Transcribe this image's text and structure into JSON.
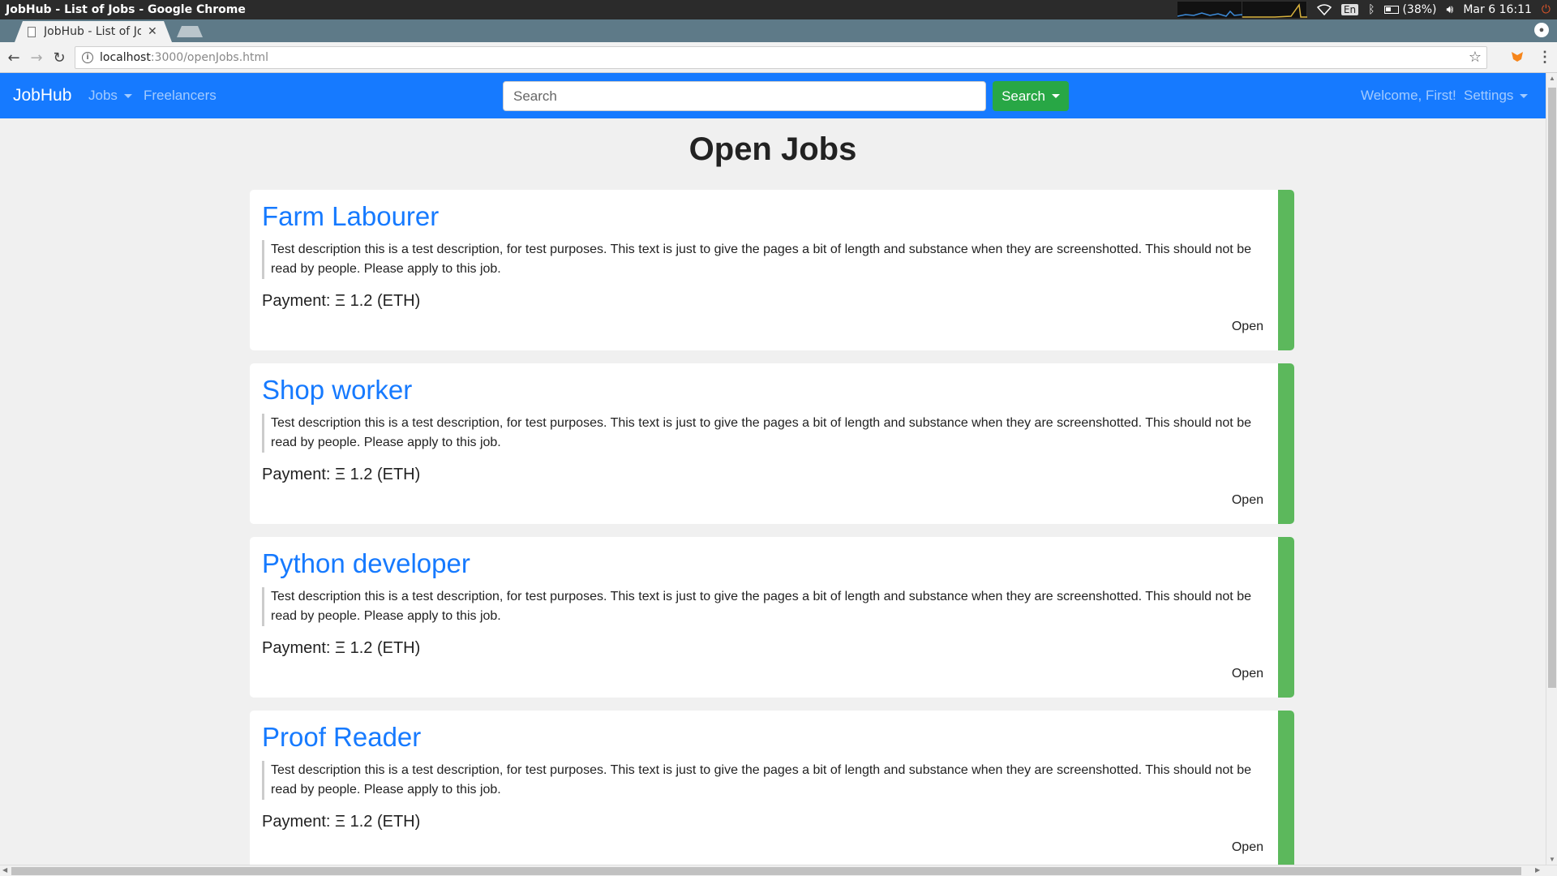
{
  "os": {
    "window_title": "JobHub - List of Jobs - Google Chrome",
    "keyboard": "En",
    "battery": "(38%)",
    "datetime": "Mar  6 16:11"
  },
  "browser": {
    "tab_title": "JobHub - List of Jobs",
    "url_host": "localhost",
    "url_path": ":3000/openJobs.html"
  },
  "navbar": {
    "brand": "JobHub",
    "jobs_label": "Jobs",
    "freelancers_label": "Freelancers",
    "search_placeholder": "Search",
    "search_button_label": "Search",
    "welcome_text": "Welcome, First!",
    "settings_label": "Settings"
  },
  "page": {
    "title": "Open Jobs"
  },
  "jobs": [
    {
      "title": "Farm Labourer",
      "description": "Test description this is a test description, for test purposes. This text is just to give the pages a bit of length and substance when they are screenshotted. This should not be read by people. Please apply to this job.",
      "payment": "Payment: Ξ 1.2 (ETH)",
      "status": "Open"
    },
    {
      "title": "Shop worker",
      "description": "Test description this is a test description, for test purposes. This text is just to give the pages a bit of length and substance when they are screenshotted. This should not be read by people. Please apply to this job.",
      "payment": "Payment: Ξ 1.2 (ETH)",
      "status": "Open"
    },
    {
      "title": "Python developer",
      "description": "Test description this is a test description, for test purposes. This text is just to give the pages a bit of length and substance when they are screenshotted. This should not be read by people. Please apply to this job.",
      "payment": "Payment: Ξ 1.2 (ETH)",
      "status": "Open"
    },
    {
      "title": "Proof Reader",
      "description": "Test description this is a test description, for test purposes. This text is just to give the pages a bit of length and substance when they are screenshotted. This should not be read by people. Please apply to this job.",
      "payment": "Payment: Ξ 1.2 (ETH)",
      "status": "Open"
    }
  ],
  "colors": {
    "navbar": "#167aff",
    "search_button": "#28a745",
    "status_open": "#5cb85c",
    "link": "#167aff"
  }
}
